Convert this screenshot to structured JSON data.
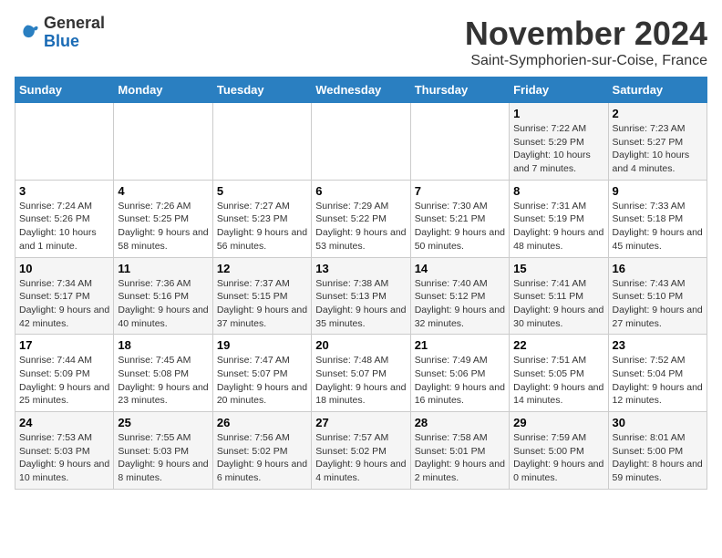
{
  "logo": {
    "general": "General",
    "blue": "Blue"
  },
  "header": {
    "month_title": "November 2024",
    "subtitle": "Saint-Symphorien-sur-Coise, France"
  },
  "calendar": {
    "days_of_week": [
      "Sunday",
      "Monday",
      "Tuesday",
      "Wednesday",
      "Thursday",
      "Friday",
      "Saturday"
    ],
    "weeks": [
      [
        {
          "day": "",
          "info": ""
        },
        {
          "day": "",
          "info": ""
        },
        {
          "day": "",
          "info": ""
        },
        {
          "day": "",
          "info": ""
        },
        {
          "day": "",
          "info": ""
        },
        {
          "day": "1",
          "info": "Sunrise: 7:22 AM\nSunset: 5:29 PM\nDaylight: 10 hours and 7 minutes."
        },
        {
          "day": "2",
          "info": "Sunrise: 7:23 AM\nSunset: 5:27 PM\nDaylight: 10 hours and 4 minutes."
        }
      ],
      [
        {
          "day": "3",
          "info": "Sunrise: 7:24 AM\nSunset: 5:26 PM\nDaylight: 10 hours and 1 minute."
        },
        {
          "day": "4",
          "info": "Sunrise: 7:26 AM\nSunset: 5:25 PM\nDaylight: 9 hours and 58 minutes."
        },
        {
          "day": "5",
          "info": "Sunrise: 7:27 AM\nSunset: 5:23 PM\nDaylight: 9 hours and 56 minutes."
        },
        {
          "day": "6",
          "info": "Sunrise: 7:29 AM\nSunset: 5:22 PM\nDaylight: 9 hours and 53 minutes."
        },
        {
          "day": "7",
          "info": "Sunrise: 7:30 AM\nSunset: 5:21 PM\nDaylight: 9 hours and 50 minutes."
        },
        {
          "day": "8",
          "info": "Sunrise: 7:31 AM\nSunset: 5:19 PM\nDaylight: 9 hours and 48 minutes."
        },
        {
          "day": "9",
          "info": "Sunrise: 7:33 AM\nSunset: 5:18 PM\nDaylight: 9 hours and 45 minutes."
        }
      ],
      [
        {
          "day": "10",
          "info": "Sunrise: 7:34 AM\nSunset: 5:17 PM\nDaylight: 9 hours and 42 minutes."
        },
        {
          "day": "11",
          "info": "Sunrise: 7:36 AM\nSunset: 5:16 PM\nDaylight: 9 hours and 40 minutes."
        },
        {
          "day": "12",
          "info": "Sunrise: 7:37 AM\nSunset: 5:15 PM\nDaylight: 9 hours and 37 minutes."
        },
        {
          "day": "13",
          "info": "Sunrise: 7:38 AM\nSunset: 5:13 PM\nDaylight: 9 hours and 35 minutes."
        },
        {
          "day": "14",
          "info": "Sunrise: 7:40 AM\nSunset: 5:12 PM\nDaylight: 9 hours and 32 minutes."
        },
        {
          "day": "15",
          "info": "Sunrise: 7:41 AM\nSunset: 5:11 PM\nDaylight: 9 hours and 30 minutes."
        },
        {
          "day": "16",
          "info": "Sunrise: 7:43 AM\nSunset: 5:10 PM\nDaylight: 9 hours and 27 minutes."
        }
      ],
      [
        {
          "day": "17",
          "info": "Sunrise: 7:44 AM\nSunset: 5:09 PM\nDaylight: 9 hours and 25 minutes."
        },
        {
          "day": "18",
          "info": "Sunrise: 7:45 AM\nSunset: 5:08 PM\nDaylight: 9 hours and 23 minutes."
        },
        {
          "day": "19",
          "info": "Sunrise: 7:47 AM\nSunset: 5:07 PM\nDaylight: 9 hours and 20 minutes."
        },
        {
          "day": "20",
          "info": "Sunrise: 7:48 AM\nSunset: 5:07 PM\nDaylight: 9 hours and 18 minutes."
        },
        {
          "day": "21",
          "info": "Sunrise: 7:49 AM\nSunset: 5:06 PM\nDaylight: 9 hours and 16 minutes."
        },
        {
          "day": "22",
          "info": "Sunrise: 7:51 AM\nSunset: 5:05 PM\nDaylight: 9 hours and 14 minutes."
        },
        {
          "day": "23",
          "info": "Sunrise: 7:52 AM\nSunset: 5:04 PM\nDaylight: 9 hours and 12 minutes."
        }
      ],
      [
        {
          "day": "24",
          "info": "Sunrise: 7:53 AM\nSunset: 5:03 PM\nDaylight: 9 hours and 10 minutes."
        },
        {
          "day": "25",
          "info": "Sunrise: 7:55 AM\nSunset: 5:03 PM\nDaylight: 9 hours and 8 minutes."
        },
        {
          "day": "26",
          "info": "Sunrise: 7:56 AM\nSunset: 5:02 PM\nDaylight: 9 hours and 6 minutes."
        },
        {
          "day": "27",
          "info": "Sunrise: 7:57 AM\nSunset: 5:02 PM\nDaylight: 9 hours and 4 minutes."
        },
        {
          "day": "28",
          "info": "Sunrise: 7:58 AM\nSunset: 5:01 PM\nDaylight: 9 hours and 2 minutes."
        },
        {
          "day": "29",
          "info": "Sunrise: 7:59 AM\nSunset: 5:00 PM\nDaylight: 9 hours and 0 minutes."
        },
        {
          "day": "30",
          "info": "Sunrise: 8:01 AM\nSunset: 5:00 PM\nDaylight: 8 hours and 59 minutes."
        }
      ]
    ]
  }
}
